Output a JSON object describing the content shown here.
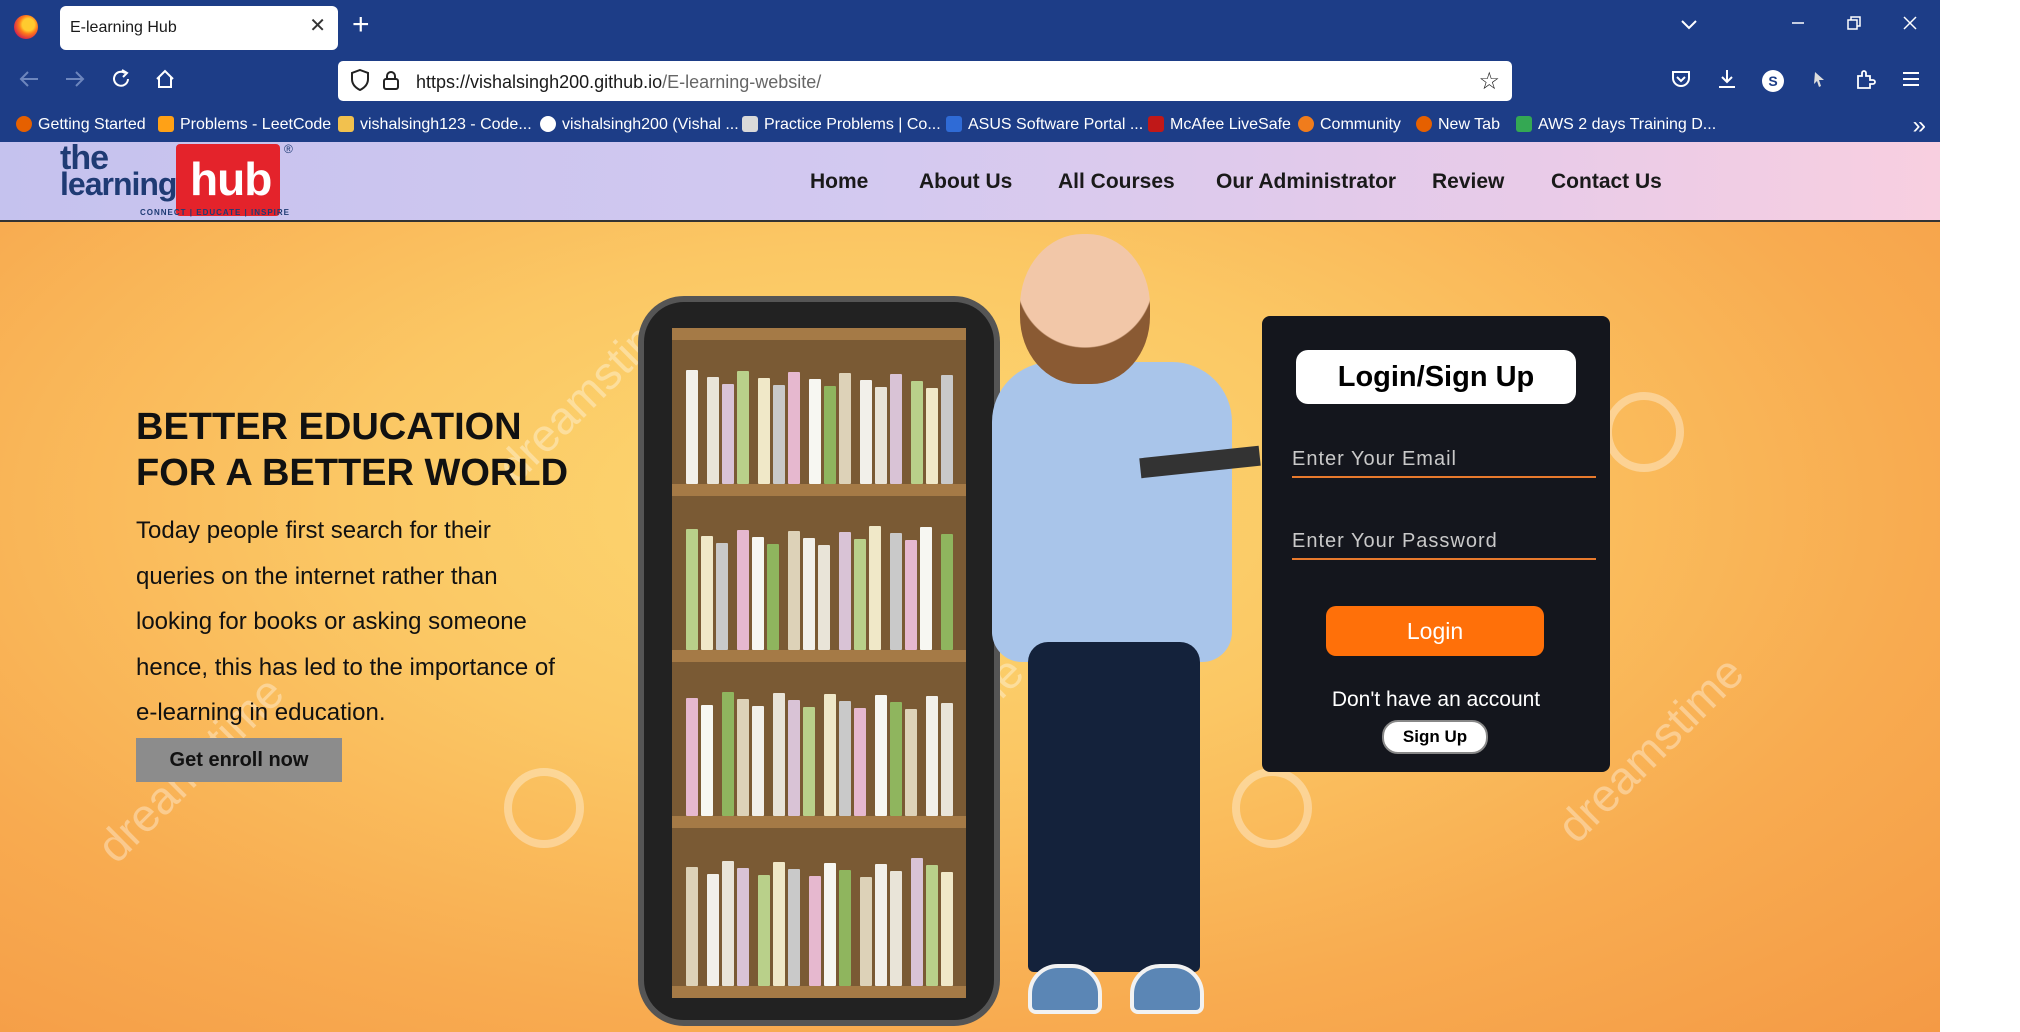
{
  "browser": {
    "tab_title": "E-learning Hub",
    "tab_close": "✕",
    "new_tab": "+",
    "url_host": "https://vishalsingh200.github.io",
    "url_path": "/E-learning-website/",
    "profile_initial": "S",
    "bookmarks": [
      {
        "label": "Getting Started",
        "color": "#e66000"
      },
      {
        "label": "Problems - LeetCode",
        "color": "#ffa116"
      },
      {
        "label": "vishalsingh123 - Code...",
        "color": "#f2c14e"
      },
      {
        "label": "vishalsingh200 (Vishal ...",
        "color": "#ffffff"
      },
      {
        "label": "Practice Problems | Co...",
        "color": "#d9d9d9"
      },
      {
        "label": "ASUS Software Portal ...",
        "color": "#2f6bd6"
      },
      {
        "label": "McAfee LiveSafe",
        "color": "#c01818"
      },
      {
        "label": "Community",
        "color": "#f07c1c"
      },
      {
        "label": "New Tab",
        "color": "#e66000"
      },
      {
        "label": "AWS 2 days Training D...",
        "color": "#34a853"
      }
    ]
  },
  "site": {
    "logo": {
      "the": "the",
      "learning": "learning",
      "hub": "hub",
      "tagline": "CONNECT | EDUCATE | INSPIRE",
      "reg": "®"
    },
    "menu": [
      "Home",
      "About Us",
      "All Courses",
      "Our Administrator",
      "Review",
      "Contact Us"
    ],
    "hero": {
      "title_line1": "BETTER EDUCATION",
      "title_line2": "FOR A BETTER WORLD",
      "text": "Today people first search for their queries on the internet rather than looking for books or asking someone hence, this has led to the importance of e-learning in education.",
      "enroll_label": "Get enroll now",
      "watermark": "dreamstime"
    },
    "login": {
      "title": "Login/Sign Up",
      "email_placeholder": "Enter Your Email",
      "password_placeholder": "Enter Your Password",
      "login_label": "Login",
      "no_account": "Don't have an account",
      "signup_label": "Sign Up"
    }
  }
}
